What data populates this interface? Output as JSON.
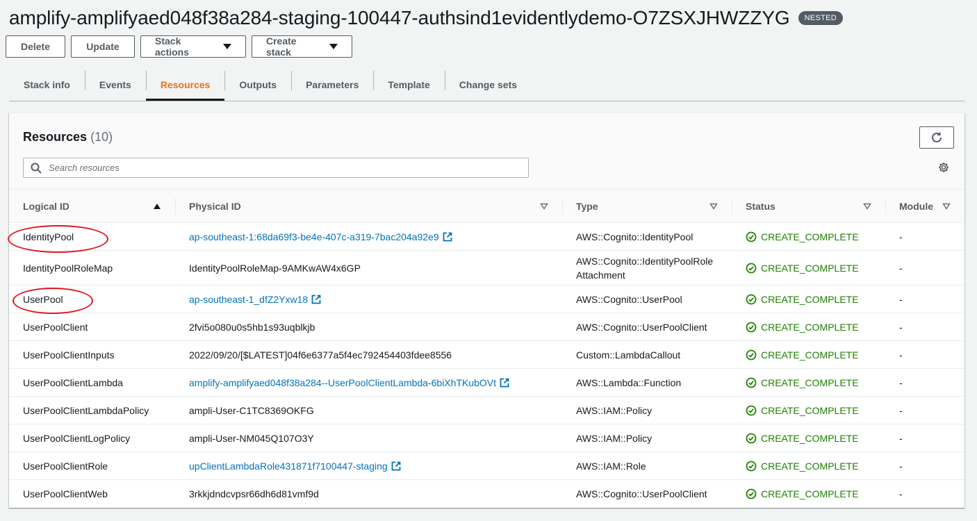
{
  "header": {
    "title": "amplify-amplifyaed048f38a284-staging-100447-authsind1evidentlydemo-O7ZSXJHWZZYG",
    "badge": "NESTED"
  },
  "actions": {
    "delete_label": "Delete",
    "update_label": "Update",
    "stack_actions_label": "Stack actions",
    "create_stack_label": "Create stack"
  },
  "tabs": [
    {
      "label": "Stack info"
    },
    {
      "label": "Events"
    },
    {
      "label": "Resources",
      "active": true
    },
    {
      "label": "Outputs"
    },
    {
      "label": "Parameters"
    },
    {
      "label": "Template"
    },
    {
      "label": "Change sets"
    }
  ],
  "resources": {
    "title": "Resources",
    "count": "(10)",
    "search_placeholder": "Search resources",
    "columns": {
      "logical_id": "Logical ID",
      "physical_id": "Physical ID",
      "type": "Type",
      "status": "Status",
      "module": "Module"
    },
    "rows": [
      {
        "logical_id": "IdentityPool",
        "physical_id": "ap-southeast-1:68da69f3-be4e-407c-a319-7bac204a92e9",
        "type": "AWS::Cognito::IdentityPool",
        "status": "CREATE_COMPLETE",
        "module": "-"
      },
      {
        "logical_id": "IdentityPoolRoleMap",
        "physical_id": "IdentityPoolRoleMap-9AMKwAW4x6GP",
        "type": "AWS::Cognito::IdentityPoolRole Attachment",
        "status": "CREATE_COMPLETE",
        "module": "-"
      },
      {
        "logical_id": "UserPool",
        "physical_id": "ap-southeast-1_dfZ2Yxw18",
        "type": "AWS::Cognito::UserPool",
        "status": "CREATE_COMPLETE",
        "module": "-"
      },
      {
        "logical_id": "UserPoolClient",
        "physical_id": "2fvi5o080u0s5hb1s93uqblkjb",
        "type": "AWS::Cognito::UserPoolClient",
        "status": "CREATE_COMPLETE",
        "module": "-"
      },
      {
        "logical_id": "UserPoolClientInputs",
        "physical_id": "2022/09/20/[$LATEST]04f6e6377a5f4ec792454403fdee8556",
        "type": "Custom::LambdaCallout",
        "status": "CREATE_COMPLETE",
        "module": "-"
      },
      {
        "logical_id": "UserPoolClientLambda",
        "physical_id": "amplify-amplifyaed048f38a284--UserPoolClientLambda-6biXhTKubOVt",
        "type": "AWS::Lambda::Function",
        "status": "CREATE_COMPLETE",
        "module": "-"
      },
      {
        "logical_id": "UserPoolClientLambdaPolicy",
        "physical_id": "ampli-User-C1TC8369OKFG",
        "type": "AWS::IAM::Policy",
        "status": "CREATE_COMPLETE",
        "module": "-"
      },
      {
        "logical_id": "UserPoolClientLogPolicy",
        "physical_id": "ampli-User-NM045Q107O3Y",
        "type": "AWS::IAM::Policy",
        "status": "CREATE_COMPLETE",
        "module": "-"
      },
      {
        "logical_id": "UserPoolClientRole",
        "physical_id": "upClientLambdaRole431871f7100447-staging",
        "type": "AWS::IAM::Role",
        "status": "CREATE_COMPLETE",
        "module": "-"
      },
      {
        "logical_id": "UserPoolClientWeb",
        "physical_id": "3rkkjdndcvpsr66dh6d81vmf9d",
        "type": "AWS::Cognito::UserPoolClient",
        "status": "CREATE_COMPLETE",
        "module": "-"
      }
    ]
  },
  "icons": {
    "status": "check-circle-icon",
    "external_link": "external-link-icon",
    "refresh": "refresh-icon",
    "settings": "gear-icon",
    "search": "search-icon",
    "sort_asc": "sort-ascending-icon",
    "filter": "sort-dropdown-icon"
  },
  "colors": {
    "accent_tab": "#ec7211",
    "link": "#0073bb",
    "success": "#1d8102",
    "annotation": "#e3121c"
  }
}
